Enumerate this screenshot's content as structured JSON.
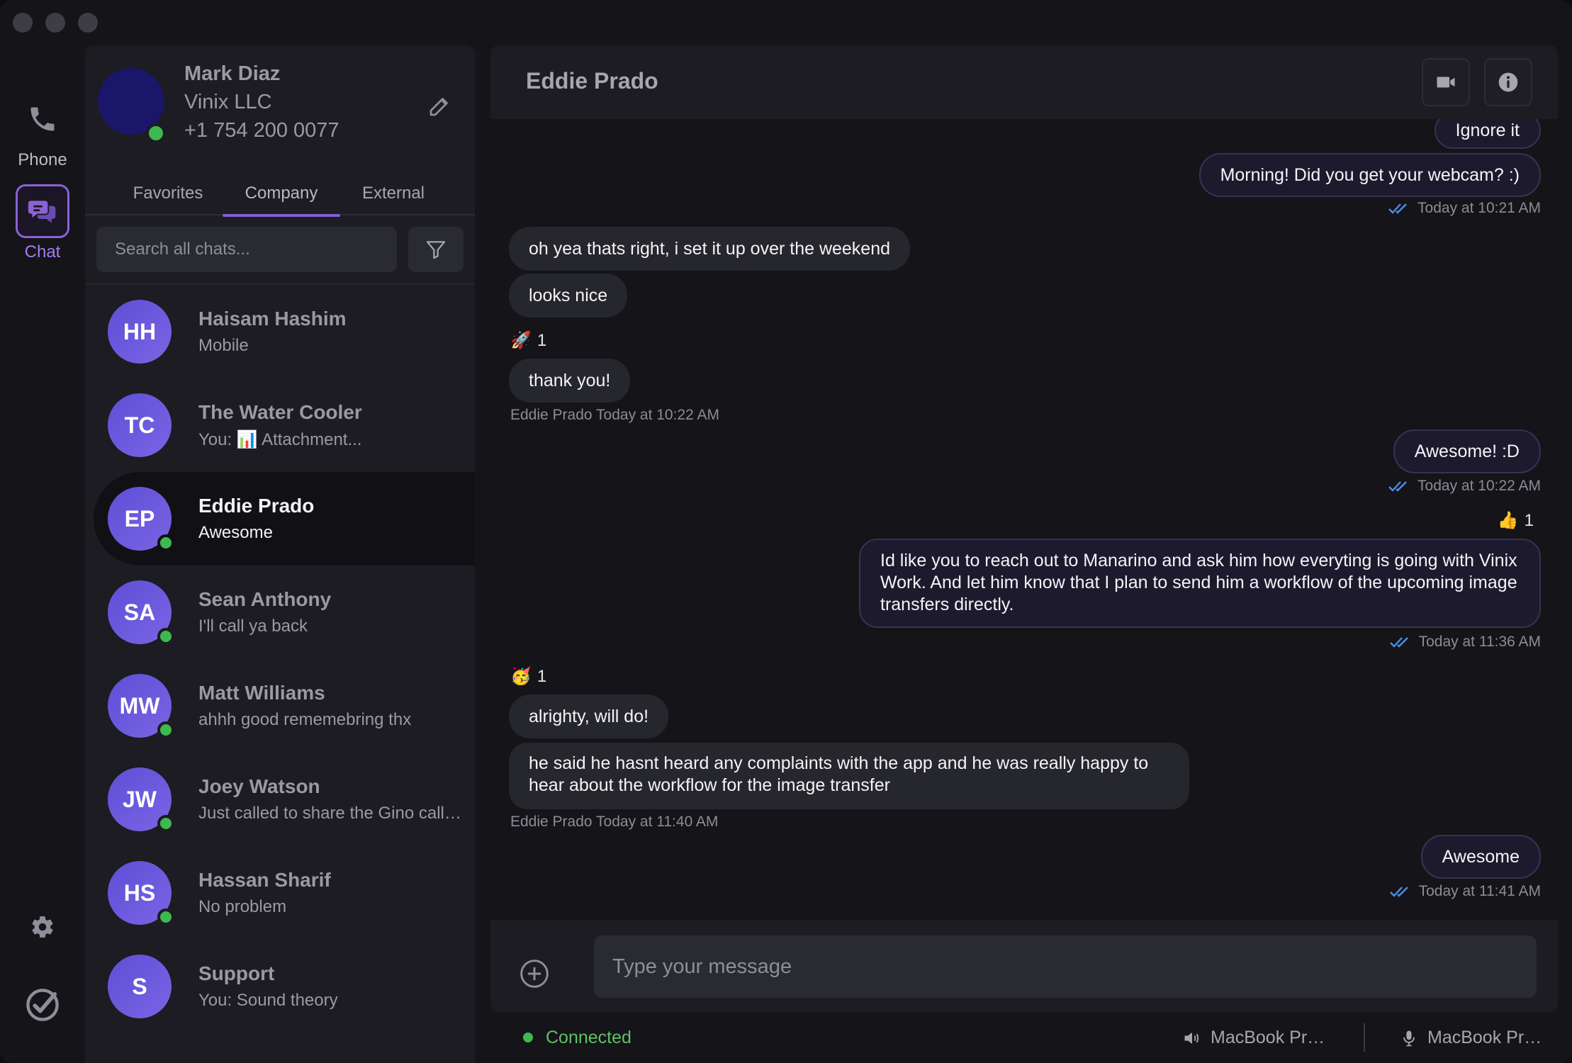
{
  "rail": {
    "phone_label": "Phone",
    "chat_label": "Chat"
  },
  "profile": {
    "name": "Mark Diaz",
    "company": "Vinix LLC",
    "phone": "+1 754 200 0077"
  },
  "tabs": [
    "Favorites",
    "Company",
    "External"
  ],
  "active_tab": "Company",
  "search": {
    "placeholder": "Search all chats..."
  },
  "contacts": [
    {
      "initials": "HH",
      "name": "Haisam Hashim",
      "sub": "Mobile",
      "online": false
    },
    {
      "initials": "TC",
      "name": "The Water Cooler",
      "sub": "You: 📊 Attachment...",
      "online": false
    },
    {
      "initials": "EP",
      "name": "Eddie Prado",
      "sub": "Awesome",
      "online": true,
      "selected": true
    },
    {
      "initials": "SA",
      "name": "Sean Anthony",
      "sub": "I'll call ya back",
      "online": true
    },
    {
      "initials": "MW",
      "name": "Matt Williams",
      "sub": "ahhh good rememebring thx",
      "online": true
    },
    {
      "initials": "JW",
      "name": "Joey Watson",
      "sub": "Just called to share the Gino call…",
      "online": true
    },
    {
      "initials": "HS",
      "name": "Hassan Sharif",
      "sub": "No problem",
      "online": true
    },
    {
      "initials": "S",
      "name": "Support",
      "sub": "You: Sound theory",
      "online": false
    }
  ],
  "chat": {
    "title": "Eddie Prado",
    "messages": [
      {
        "dir": "out",
        "text": "Ignore it"
      },
      {
        "dir": "out",
        "text": "Morning! Did you get your webcam? :)"
      },
      {
        "dir": "meta_out",
        "text": "Today at 10:21 AM"
      },
      {
        "dir": "in",
        "text": "oh yea thats right, i set it up over the weekend"
      },
      {
        "dir": "in",
        "text": "looks nice"
      },
      {
        "dir": "reaction",
        "emoji": "🚀",
        "count": "1"
      },
      {
        "dir": "in",
        "text": "thank you!"
      },
      {
        "dir": "meta_in",
        "text": "Eddie Prado Today at 10:22 AM"
      },
      {
        "dir": "out",
        "text": "Awesome! :D"
      },
      {
        "dir": "meta_out",
        "text": "Today at 10:22 AM"
      },
      {
        "dir": "reaction",
        "emoji": "👍",
        "count": "1"
      },
      {
        "dir": "out",
        "text": "Id like you to reach out to Manarino and ask him how everyting is going with Vinix Work. And let him know that I plan to send him a workflow of the upcoming image transfers directly."
      },
      {
        "dir": "meta_out",
        "text": "Today at 11:36 AM"
      },
      {
        "dir": "reaction",
        "emoji": "🥳",
        "count": "1"
      },
      {
        "dir": "in",
        "text": "alrighty, will do!"
      },
      {
        "dir": "in",
        "text": "he said he hasnt heard any complaints with the app and he was really happy to hear about the workflow for the image transfer"
      },
      {
        "dir": "meta_in",
        "text": "Eddie Prado Today at 11:40 AM"
      },
      {
        "dir": "out",
        "text": "Awesome"
      },
      {
        "dir": "meta_out",
        "text": "Today at 11:41 AM"
      }
    ]
  },
  "composer": {
    "placeholder": "Type your message"
  },
  "statusbar": {
    "status": "Connected",
    "speaker": "MacBook Pr…",
    "mic": "MacBook Pr…"
  },
  "colors": {
    "accent": "#7d61d9",
    "online": "#3fb94f",
    "read_check": "#4a8fe7"
  }
}
